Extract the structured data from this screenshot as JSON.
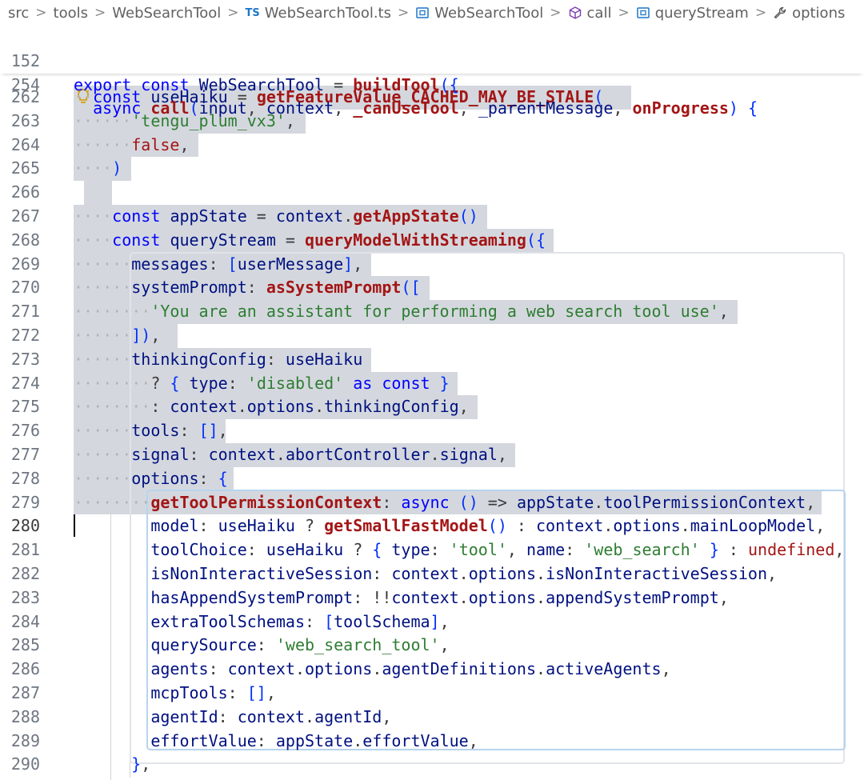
{
  "breadcrumb": {
    "items": [
      "src",
      "tools",
      "WebSearchTool",
      "WebSearchTool.ts",
      "WebSearchTool",
      "call",
      "queryStream",
      "options"
    ],
    "ts_badge": "TS",
    "separator": ">"
  },
  "sticky_lines": [
    {
      "num": "152",
      "text": "export const WebSearchTool = buildTool({"
    },
    {
      "num": "254",
      "text": "  async call(input, context, _canUseTool, _parentMessage, onProgress) {"
    }
  ],
  "lines": [
    {
      "num": "262",
      "text": "··const useHaiku = getFeatureValue_CACHED_MAY_BE_STALE("
    },
    {
      "num": "263",
      "text": "······'tengu_plum_vx3',"
    },
    {
      "num": "264",
      "text": "······false,"
    },
    {
      "num": "265",
      "text": "····)"
    },
    {
      "num": "266",
      "text": ""
    },
    {
      "num": "267",
      "text": "····const appState = context.getAppState()"
    },
    {
      "num": "268",
      "text": "····const queryStream = queryModelWithStreaming({"
    },
    {
      "num": "269",
      "text": "······messages: [userMessage],"
    },
    {
      "num": "270",
      "text": "······systemPrompt: asSystemPrompt(["
    },
    {
      "num": "271",
      "text": "········'You are an assistant for performing a web search tool use',"
    },
    {
      "num": "272",
      "text": "······]),"
    },
    {
      "num": "273",
      "text": "······thinkingConfig: useHaiku"
    },
    {
      "num": "274",
      "text": "········? { type: 'disabled' as const }"
    },
    {
      "num": "275",
      "text": "········: context.options.thinkingConfig,"
    },
    {
      "num": "276",
      "text": "······tools: [],"
    },
    {
      "num": "277",
      "text": "······signal: context.abortController.signal,"
    },
    {
      "num": "278",
      "text": "······options: {"
    },
    {
      "num": "279",
      "text": "········getToolPermissionContext: async () => appState.toolPermissionContext,"
    },
    {
      "num": "280",
      "text": "        model: useHaiku ? getSmallFastModel() : context.options.mainLoopModel,"
    },
    {
      "num": "281",
      "text": "        toolChoice: useHaiku ? { type: 'tool', name: 'web_search' } : undefined,"
    },
    {
      "num": "282",
      "text": "        isNonInteractiveSession: context.options.isNonInteractiveSession,"
    },
    {
      "num": "283",
      "text": "        hasAppendSystemPrompt: !!context.options.appendSystemPrompt,"
    },
    {
      "num": "284",
      "text": "        extraToolSchemas: [toolSchema],"
    },
    {
      "num": "285",
      "text": "        querySource: 'web_search_tool',"
    },
    {
      "num": "286",
      "text": "        agents: context.options.agentDefinitions.activeAgents,"
    },
    {
      "num": "287",
      "text": "        mcpTools: [],"
    },
    {
      "num": "288",
      "text": "        agentId: context.agentId,"
    },
    {
      "num": "289",
      "text": "        effortValue: appState.effortValue,"
    },
    {
      "num": "290",
      "text": "      },"
    }
  ],
  "colors": {
    "selection": "#d4d8de",
    "scope_box": "#b7d3ef",
    "keyword": "#0000ff",
    "function": "#a31515",
    "string": "#2e7d32"
  }
}
